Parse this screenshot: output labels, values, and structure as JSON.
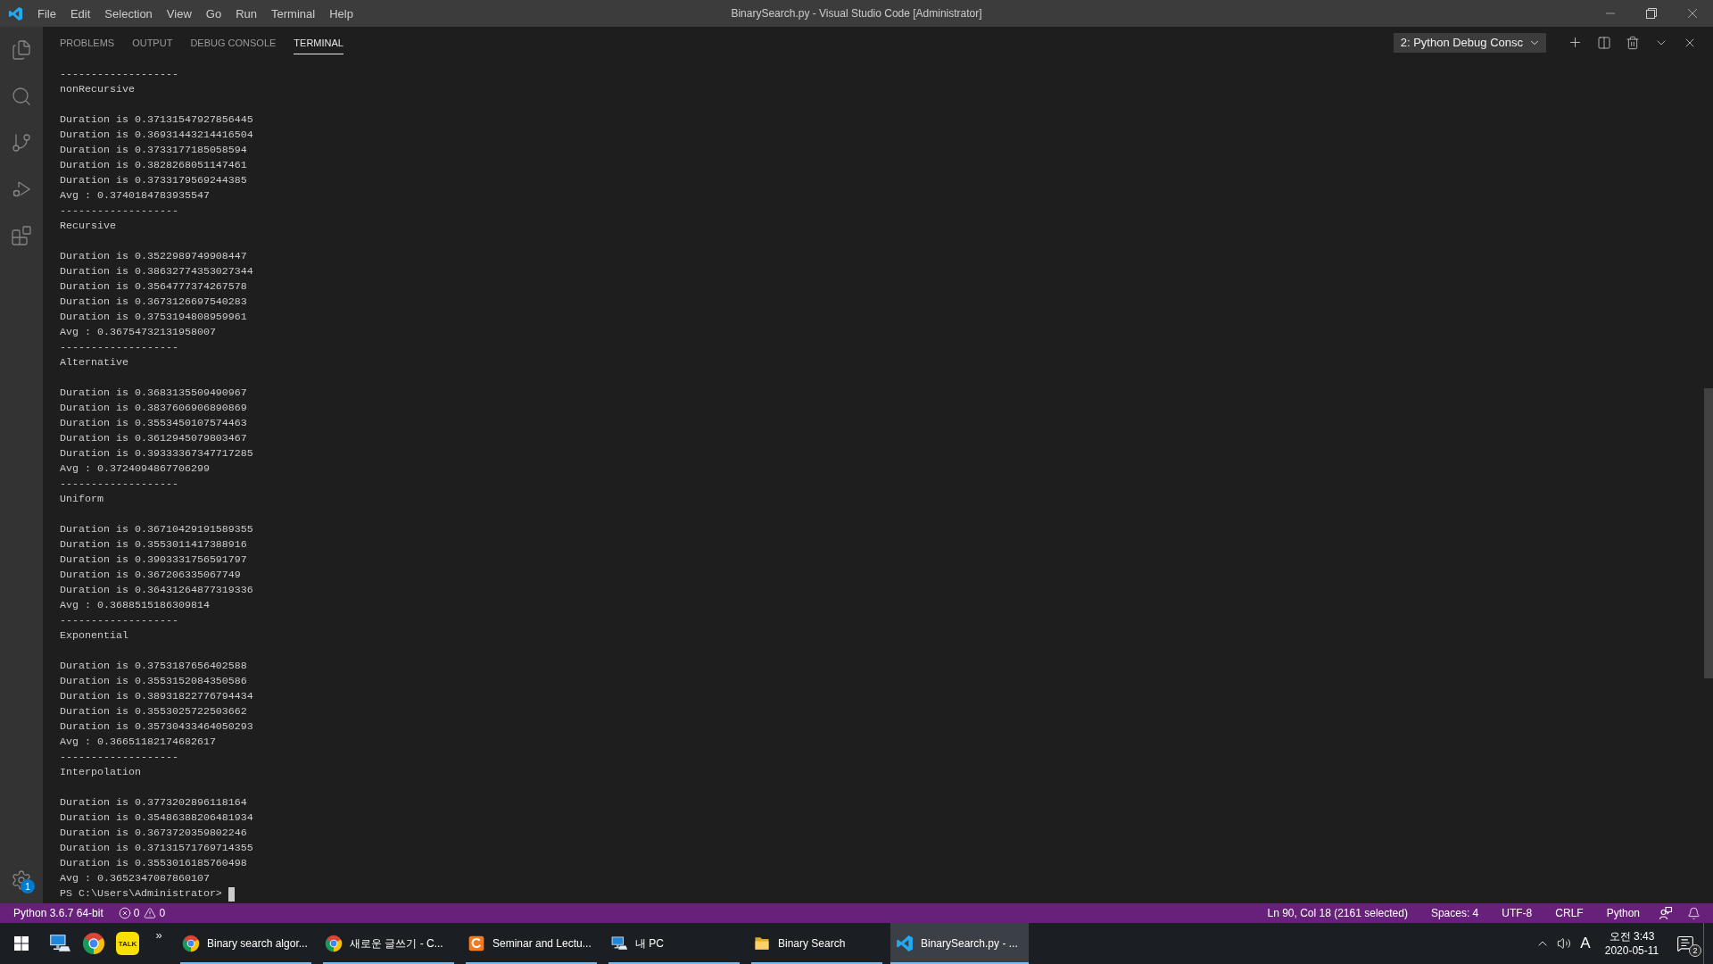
{
  "window": {
    "title": "BinarySearch.py - Visual Studio Code [Administrator]"
  },
  "menu": [
    "File",
    "Edit",
    "Selection",
    "View",
    "Go",
    "Run",
    "Terminal",
    "Help"
  ],
  "activity_bar": {
    "settings_badge": "1"
  },
  "panel": {
    "tabs": [
      {
        "label": "PROBLEMS",
        "selected": false
      },
      {
        "label": "OUTPUT",
        "selected": false
      },
      {
        "label": "DEBUG CONSOLE",
        "selected": false
      },
      {
        "label": "TERMINAL",
        "selected": true
      }
    ],
    "terminal_picker": "2: Python Debug Consc"
  },
  "terminal": {
    "sections": [
      {
        "separator": "-------------------",
        "title": "nonRecursive",
        "durations": [
          "Duration is 0.37131547927856445",
          "Duration is 0.36931443214416504",
          "Duration is 0.3733177185058594",
          "Duration is 0.3828268051147461",
          "Duration is 0.3733179569244385"
        ],
        "average": "Avg : 0.3740184783935547"
      },
      {
        "separator": "-------------------",
        "title": "Recursive",
        "durations": [
          "Duration is 0.3522989749908447",
          "Duration is 0.38632774353027344",
          "Duration is 0.3564777374267578",
          "Duration is 0.3673126697540283",
          "Duration is 0.3753194808959961"
        ],
        "average": "Avg : 0.36754732131958007"
      },
      {
        "separator": "-------------------",
        "title": "Alternative",
        "durations": [
          "Duration is 0.3683135509490967",
          "Duration is 0.3837606906890869",
          "Duration is 0.3553450107574463",
          "Duration is 0.3612945079803467",
          "Duration is 0.39333367347717285"
        ],
        "average": "Avg : 0.3724094867706299"
      },
      {
        "separator": "-------------------",
        "title": "Uniform",
        "durations": [
          "Duration is 0.36710429191589355",
          "Duration is 0.3553011417388916",
          "Duration is 0.3903331756591797",
          "Duration is 0.367206335067749",
          "Duration is 0.36431264877319336"
        ],
        "average": "Avg : 0.3688515186309814"
      },
      {
        "separator": "-------------------",
        "title": "Exponential",
        "durations": [
          "Duration is 0.3753187656402588",
          "Duration is 0.3553152084350586",
          "Duration is 0.38931822776794434",
          "Duration is 0.3553025722503662",
          "Duration is 0.35730433464050293"
        ],
        "average": "Avg : 0.36651182174682617"
      },
      {
        "separator": "-------------------",
        "title": "Interpolation",
        "durations": [
          "Duration is 0.3773202896118164",
          "Duration is 0.35486388206481934",
          "Duration is 0.3673720359802246",
          "Duration is 0.37131571769714355",
          "Duration is 0.3553016185760498"
        ],
        "average": "Avg : 0.3652347087860107"
      }
    ],
    "prompt": "PS C:\\Users\\Administrator>"
  },
  "status_bar": {
    "interpreter": "Python 3.6.7 64-bit",
    "errors": "0",
    "warnings": "0",
    "right_items": [
      "Ln 90, Col 18 (2161 selected)",
      "Spaces: 4",
      "UTF-8",
      "CRLF",
      "Python"
    ]
  },
  "taskbar": {
    "pinned": [
      {
        "kind": "computer"
      },
      {
        "kind": "browser"
      },
      {
        "kind": "chat",
        "logo_text": "TALK"
      }
    ],
    "overflow": "»",
    "windows": [
      {
        "kind": "browser",
        "label": "Binary search algor...",
        "selected": false
      },
      {
        "kind": "browser",
        "label": "새로운 글쓰기 - C...",
        "selected": false
      },
      {
        "kind": "document",
        "label": "Seminar and Lectu...",
        "selected": false
      },
      {
        "kind": "computer",
        "label": "내 PC",
        "selected": false
      },
      {
        "kind": "folder",
        "label": "Binary Search",
        "selected": false
      },
      {
        "kind": "editor",
        "label": "BinarySearch.py - ...",
        "selected": true
      }
    ],
    "tray": {
      "input_mode": "A",
      "time": "오전 3:43",
      "date": "2020-05-11",
      "notification_count": "2"
    }
  }
}
